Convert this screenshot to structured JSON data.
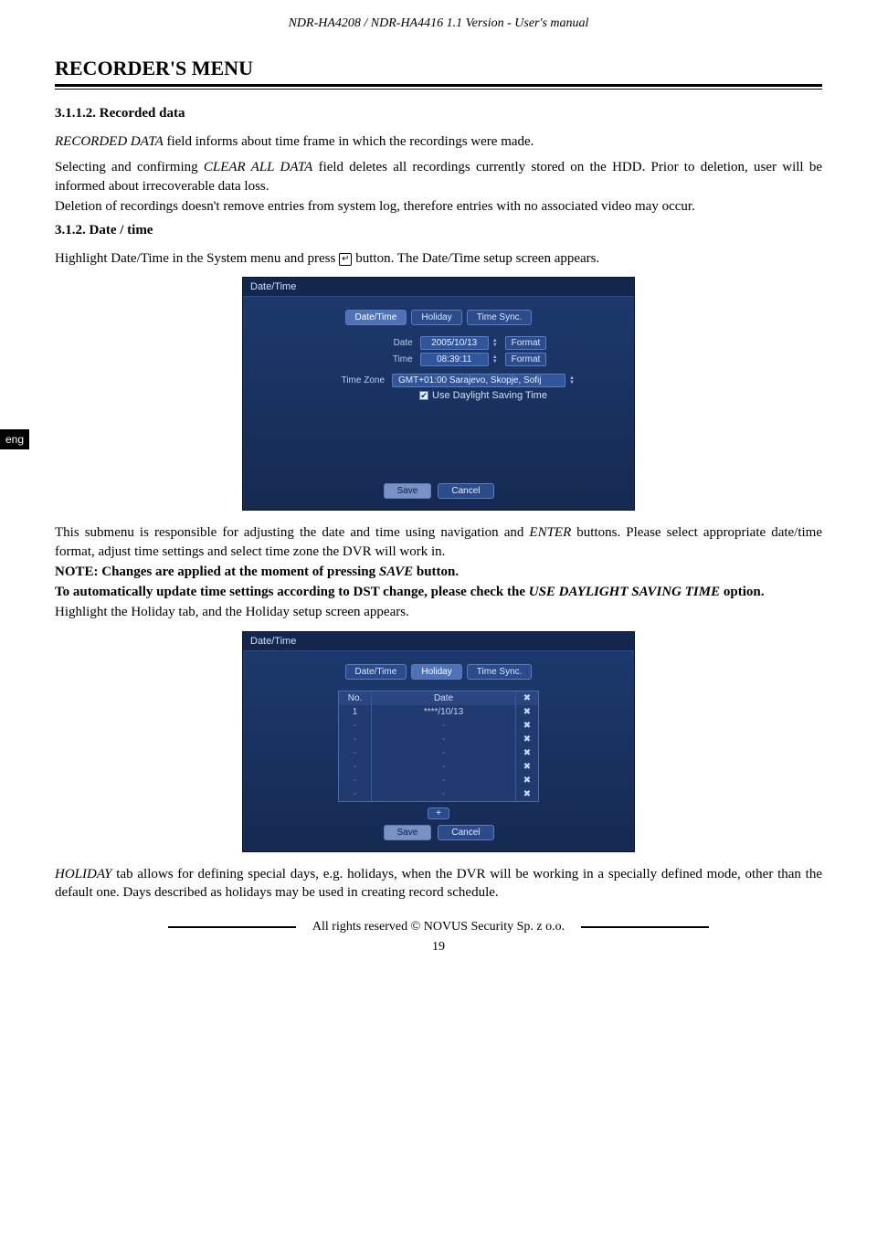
{
  "header": "NDR-HA4208 / NDR-HA4416 1.1 Version - User's manual",
  "section_title": "RECORDER'S MENU",
  "eng_tab": "eng",
  "s3112": {
    "heading": "3.1.1.2.    Recorded data",
    "p1a": "RECORDED DATA",
    "p1b": " field informs about time frame in which the recordings were made.",
    "p2a": "Selecting and confirming ",
    "p2b": "CLEAR ALL DATA",
    "p2c": " field deletes all recordings currently stored on the HDD. Prior to deletion, user will be informed about irrecoverable data loss.",
    "p3": "Deletion of recordings doesn't remove entries from system log, therefore entries with no associated video may occur."
  },
  "s312": {
    "heading": "3.1.2.    Date / time",
    "p1a": "Highlight Date/Time in the System menu and press ",
    "p1_icon": "↵",
    "p1b": " button. The Date/Time setup screen appears."
  },
  "ss1": {
    "title": "Date/Time",
    "tabs": [
      "Date/Time",
      "Holiday",
      "Time Sync."
    ],
    "active_tab": "Date/Time",
    "date_label": "Date",
    "date_val": "2005/10/13",
    "time_label": "Time",
    "time_val": "08:39:11",
    "format": "Format",
    "tz_label": "Time Zone",
    "tz_val": "GMT+01:00   Sarajevo, Skopje, Sofij",
    "dst": "Use Daylight Saving Time",
    "save": "Save",
    "cancel": "Cancel"
  },
  "mid": {
    "p1a": "This submenu is responsible for adjusting the date and time using navigation and ",
    "p1b": "ENTER",
    "p1c": " buttons. Please select appropriate date/time format, adjust time settings and select time zone the DVR will work in.",
    "note_a": "NOTE: Changes are applied at the moment of pressing ",
    "note_b": "SAVE",
    "note_c": " button.",
    "dst_a": "To automatically update time settings according to DST change, please check the ",
    "dst_b": "USE DAYLIGHT SAVING TIME",
    "dst_c": " option.",
    "holiday_intro": "Highlight the Holiday tab, and the Holiday setup screen appears."
  },
  "ss2": {
    "title": "Date/Time",
    "tabs": [
      "Date/Time",
      "Holiday",
      "Time Sync."
    ],
    "active_tab": "Holiday",
    "col_no": "No.",
    "col_date": "Date",
    "col_x": "✖",
    "rows": [
      {
        "no": "1",
        "date": "****/10/13",
        "x": "✖"
      },
      {
        "no": "-",
        "date": "-",
        "x": "✖"
      },
      {
        "no": "-",
        "date": "-",
        "x": "✖"
      },
      {
        "no": "-",
        "date": "-",
        "x": "✖"
      },
      {
        "no": "-",
        "date": "-",
        "x": "✖"
      },
      {
        "no": "-",
        "date": "-",
        "x": "✖"
      },
      {
        "no": "-",
        "date": "-",
        "x": "✖"
      }
    ],
    "plus": "+",
    "save": "Save",
    "cancel": "Cancel"
  },
  "tail": {
    "p1a": "HOLIDAY",
    "p1b": " tab allows for defining special days, e.g. holidays, when the DVR will be working in a specially defined mode, other than the default one. Days described as holidays may be used in creating record schedule."
  },
  "footer": "All rights reserved © NOVUS Security Sp. z o.o.",
  "pagenum": "19"
}
